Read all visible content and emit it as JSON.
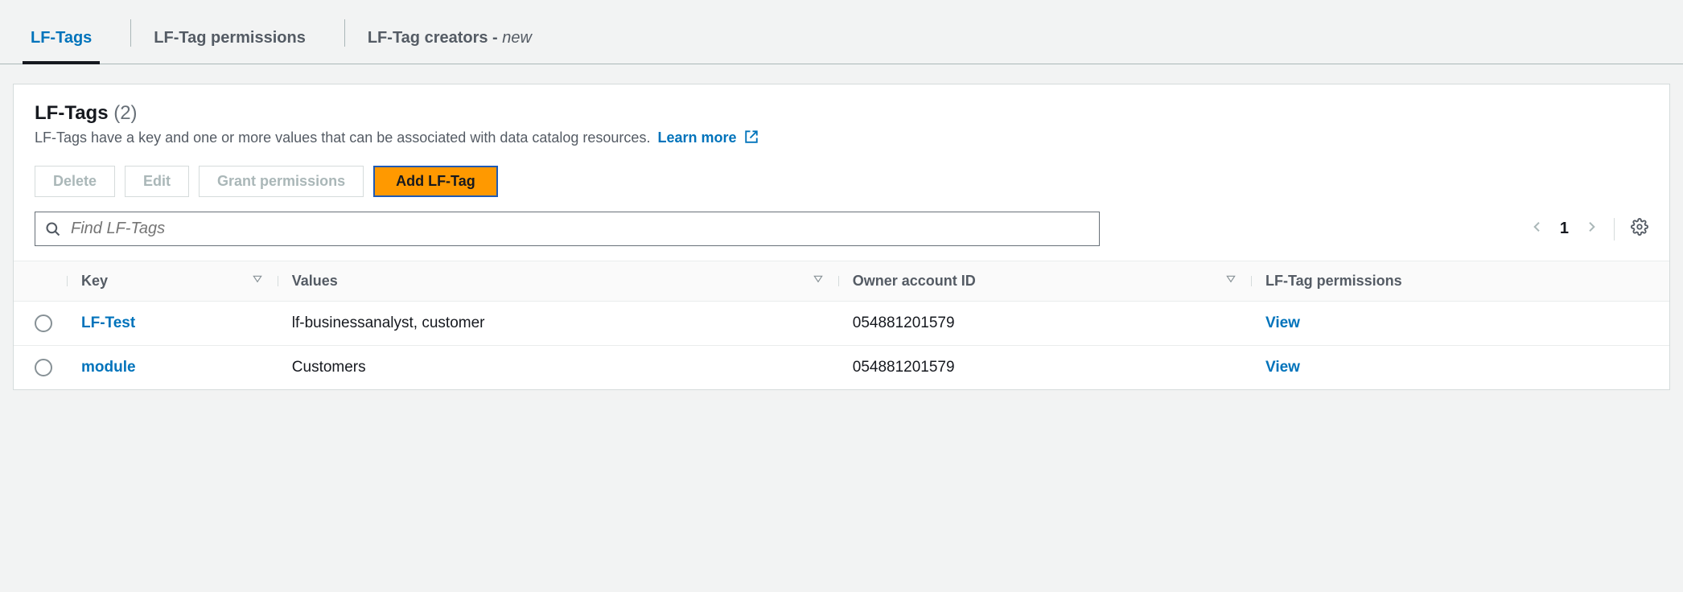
{
  "tabs": {
    "lftags": "LF-Tags",
    "permissions": "LF-Tag permissions",
    "creators_prefix": "LF-Tag creators - ",
    "creators_suffix": "new"
  },
  "panel": {
    "title": "LF-Tags",
    "count": "(2)",
    "description": "LF-Tags have a key and one or more values that can be associated with data catalog resources.",
    "learn_more": "Learn more"
  },
  "buttons": {
    "delete": "Delete",
    "edit": "Edit",
    "grant": "Grant permissions",
    "add": "Add LF-Tag"
  },
  "search": {
    "placeholder": "Find LF-Tags"
  },
  "pager": {
    "page": "1"
  },
  "columns": {
    "key": "Key",
    "values": "Values",
    "owner": "Owner account ID",
    "perms": "LF-Tag permissions"
  },
  "rows": [
    {
      "key": "LF-Test",
      "values": "lf-businessanalyst, customer",
      "owner": "054881201579",
      "perms": "View"
    },
    {
      "key": "module",
      "values": "Customers",
      "owner": "054881201579",
      "perms": "View"
    }
  ]
}
